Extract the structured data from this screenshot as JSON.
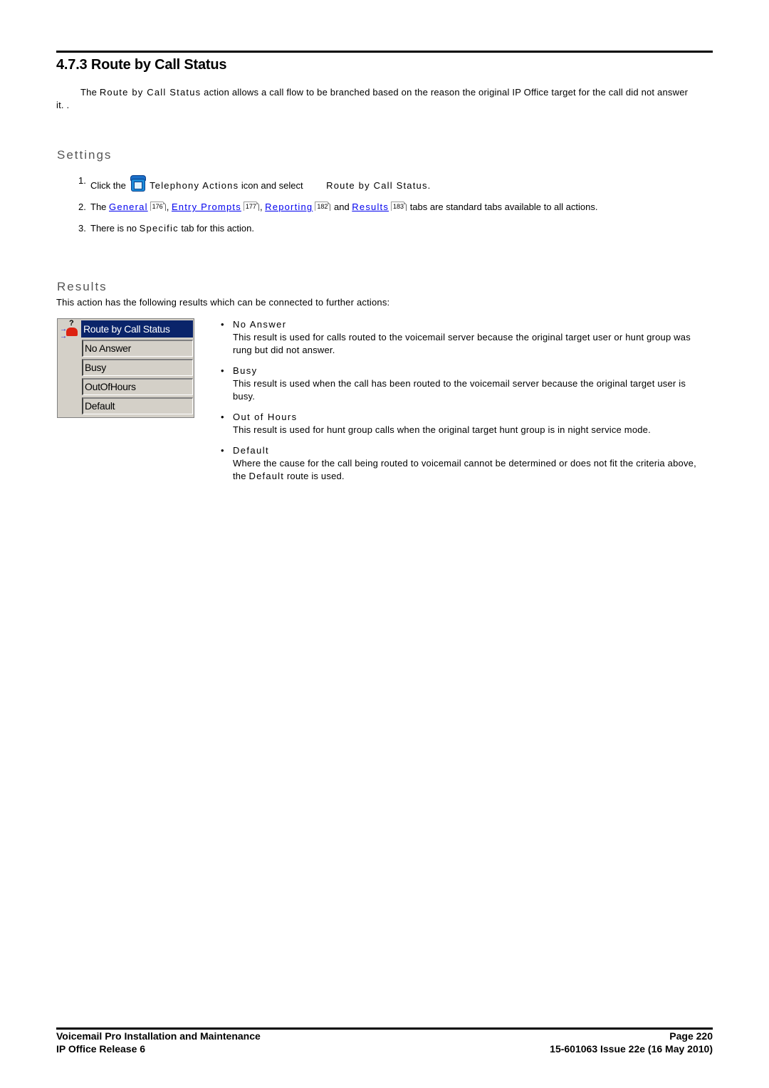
{
  "header": {
    "title": "4.7.3 Route by Call Status"
  },
  "intro": {
    "prefix": "The ",
    "action_name": "Route by Call Status",
    "suffix": " action allows a call flow to be branched based on the reason the original IP Office target for the call did not answer it. ."
  },
  "settings": {
    "heading": "Settings",
    "steps": [
      {
        "num": "1.",
        "text_before_icon": "Click the ",
        "icon": "telephony-actions-icon",
        "label_spaced": "Telephony Actions",
        "text_middle": " icon and select ",
        "action_spaced": "Route by Call Status",
        "text_end": "."
      },
      {
        "num": "2.",
        "lead": "The ",
        "links": [
          {
            "label": "General",
            "ref": "176"
          },
          {
            "label": "Entry Prompts",
            "ref": "177"
          },
          {
            "label": "Reporting",
            "ref": "182"
          },
          {
            "label": "Results",
            "ref": "183"
          }
        ],
        "sep1": ", ",
        "sep2": ", ",
        "sep3": " and ",
        "tail": " tabs are standard tabs available to all actions."
      },
      {
        "num": "3.",
        "lead": "There is no ",
        "tab_spaced": "Specific",
        "tail": " tab for this action."
      }
    ]
  },
  "results": {
    "heading": "Results",
    "intro": "This action has the following results which can be connected to further actions:",
    "node": {
      "icon": "route-by-call-status-node-icon",
      "title": "Route by Call Status",
      "outputs": [
        "No Answer",
        "Busy",
        "OutOfHours",
        "Default"
      ]
    },
    "items": [
      {
        "name": "No Answer",
        "desc": "This result is used for calls routed to the voicemail server because the original target user or hunt group was rung but did not answer."
      },
      {
        "name": "Busy",
        "desc": "This result is used when the call has been routed to the voicemail server because the original target user is busy."
      },
      {
        "name": "Out of Hours",
        "desc": "This result is used for hunt group calls when the original target hunt group is in night service mode."
      },
      {
        "name": "Default",
        "desc_before": "Where the cause for the call being routed to voicemail cannot be determined or does not fit the criteria above, the ",
        "desc_keyword": "Default",
        "desc_after": " route is used."
      }
    ]
  },
  "footer": {
    "left_top": "Voicemail Pro Installation and Maintenance",
    "left_bottom": "IP Office Release 6",
    "right_top": "Page 220",
    "right_bottom": "15-601063 Issue 22e (16 May 2010)"
  },
  "colors": {
    "link": "#0000ee",
    "heading_gray": "#555555",
    "node_title_bg": "#0a246a",
    "node_panel_bg": "#d4d0c8"
  }
}
